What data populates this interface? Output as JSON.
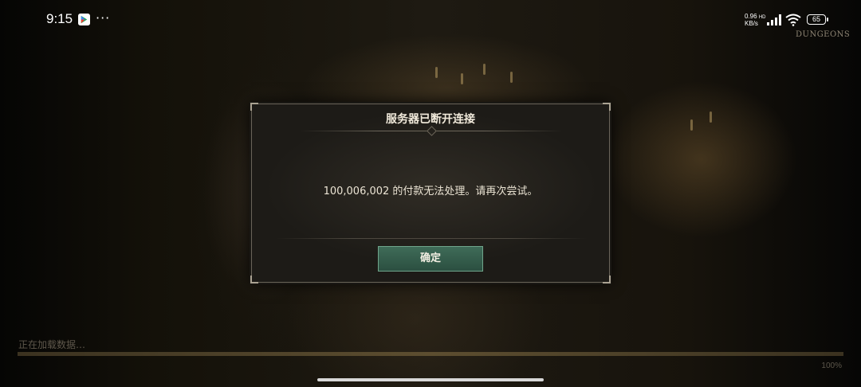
{
  "status_bar": {
    "time": "9:15",
    "more": "···",
    "net_speed_value": "0.96",
    "net_speed_unit": "KB/s",
    "hd_label": "HD",
    "battery": "65",
    "icons": [
      "play-store-icon",
      "more-icon",
      "signal-icon",
      "wifi-icon",
      "battery-icon"
    ]
  },
  "game_logo": "DUNGEONS",
  "dialog": {
    "title": "服务器已断开连接",
    "message": "100,006,002 的付款无法处理。请再次尝试。",
    "confirm_label": "确定"
  },
  "loading": {
    "label": "正在加载数据…",
    "percent_label": "100%",
    "progress": 1.0
  },
  "colors": {
    "button_bg": "#355e4d",
    "button_border": "#6fa48a",
    "dialog_bg": "#23201b",
    "dialog_border": "#6a6459"
  }
}
